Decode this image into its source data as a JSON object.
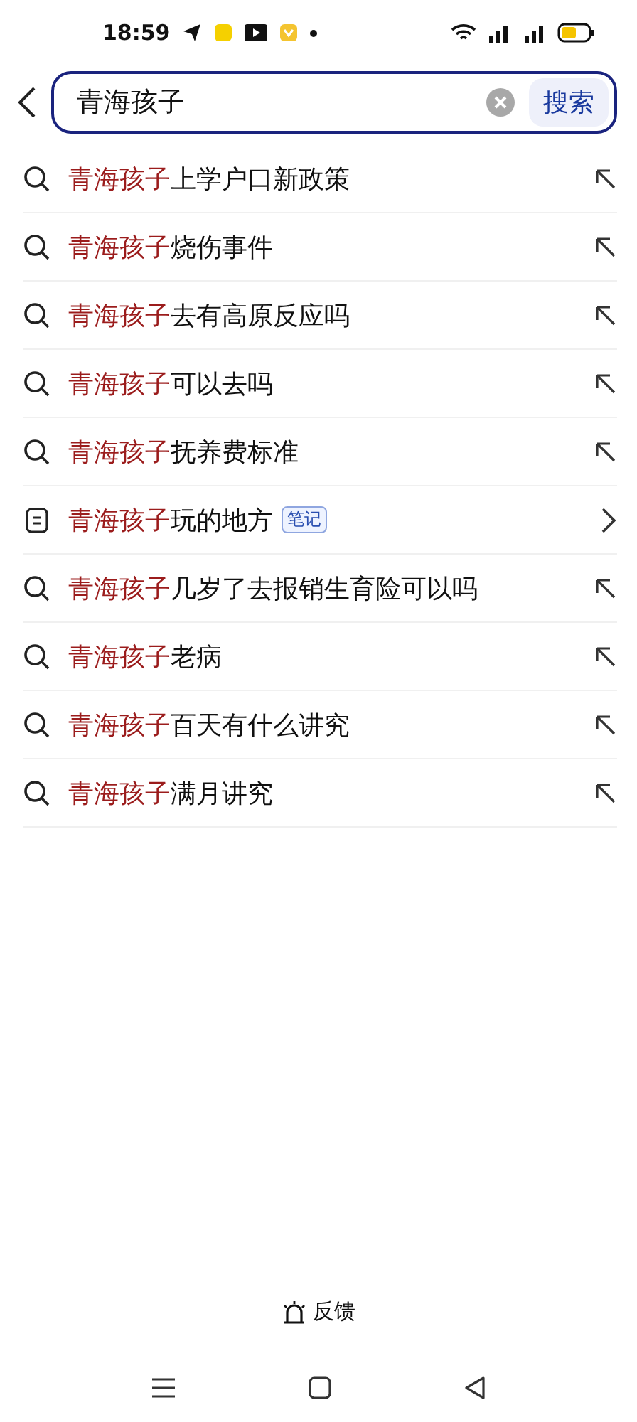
{
  "status_bar": {
    "time": "18:59"
  },
  "search": {
    "value": "青海孩子",
    "button": "搜索"
  },
  "suggestions": [
    {
      "kind": "search",
      "highlight": "青海孩子",
      "rest": "上学户口新政策"
    },
    {
      "kind": "search",
      "highlight": "青海孩子",
      "rest": "烧伤事件"
    },
    {
      "kind": "search",
      "highlight": "青海孩子",
      "rest": "去有高原反应吗"
    },
    {
      "kind": "search",
      "highlight": "青海孩子",
      "rest": "可以去吗"
    },
    {
      "kind": "search",
      "highlight": "青海孩子",
      "rest": "抚养费标准"
    },
    {
      "kind": "note",
      "highlight": "青海孩子",
      "rest": "玩的地方",
      "tag": "笔记"
    },
    {
      "kind": "search",
      "highlight": "青海孩子",
      "rest": "几岁了去报销生育险可以吗"
    },
    {
      "kind": "search",
      "highlight": "青海孩子",
      "rest": "老病"
    },
    {
      "kind": "search",
      "highlight": "青海孩子",
      "rest": "百天有什么讲究"
    },
    {
      "kind": "search",
      "highlight": "青海孩子",
      "rest": "满月讲究"
    }
  ],
  "feedback": "反馈"
}
